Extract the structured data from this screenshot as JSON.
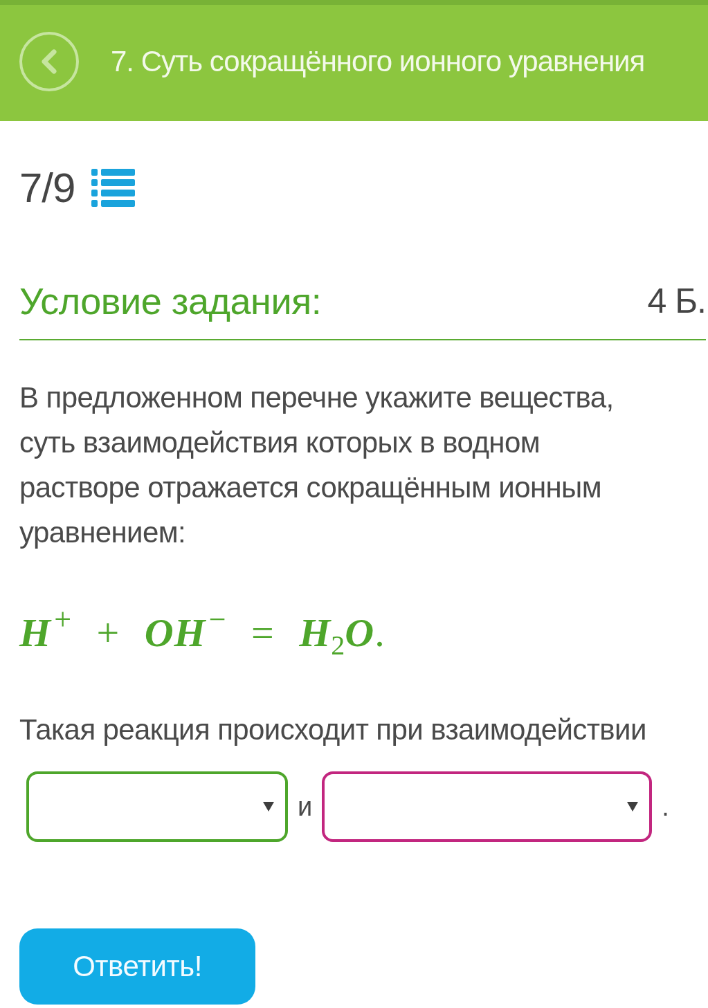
{
  "header": {
    "title": "7. Суть сокращённого ионного уравнения"
  },
  "progress": {
    "counter": "7/9"
  },
  "task": {
    "heading": "Условие задания:",
    "points": "4 Б.",
    "text": "В предложенном перечне укажите вещества, суть взаимодействия которых в водном растворе отражается сокращённым ионным уравнением:",
    "equation": "*H*$^{+}$ + *OH*$^{−}$ = *H*$_{2}$*O*.",
    "prompt": "Такая реакция происходит при взаимодействии",
    "answer_line": [
      {
        "kind": "select",
        "color": "#4ea62b"
      },
      {
        "kind": "text",
        "text": "и"
      },
      {
        "kind": "select",
        "color": "#c2267f"
      },
      {
        "kind": "text",
        "text": "."
      }
    ]
  },
  "submit_button": {
    "label": "Ответить!"
  }
}
